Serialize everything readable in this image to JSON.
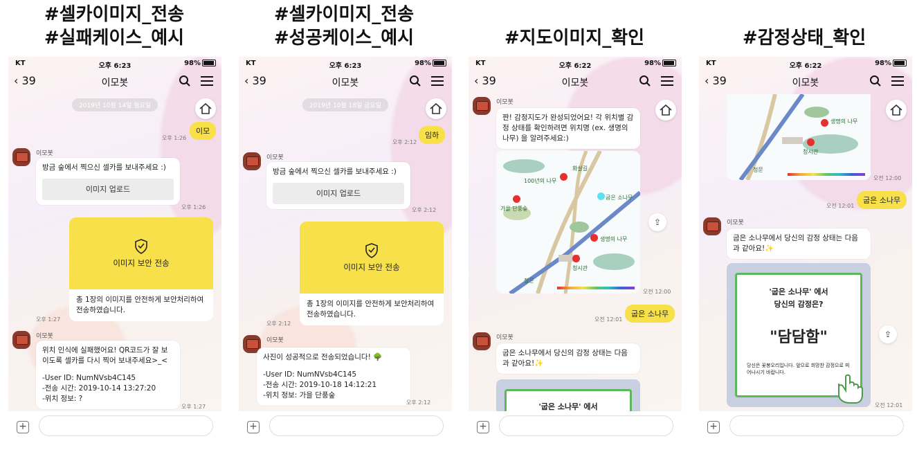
{
  "captions": [
    {
      "line1": "#셀카이미지_전송",
      "line2": "#실패케이스_예시"
    },
    {
      "line1": "#셀카이미지_전송",
      "line2": "#성공케이스_예시"
    },
    {
      "line1": "#지도이미지_확인",
      "line2": ""
    },
    {
      "line1": "#감정상태_확인",
      "line2": ""
    }
  ],
  "status": {
    "carrier": "KT",
    "battery": "98%",
    "time_a": "오후 6:23",
    "time_b": "오후 6:22"
  },
  "nav": {
    "back_count": "39",
    "title": "이모봇"
  },
  "colors": {
    "yellow": "#f7e04a",
    "marker": "#e53030",
    "frame_green": "#5cb85c"
  },
  "phone1": {
    "date": "2019년 10월 14일 월요일",
    "user_msg": "이모",
    "user_time": "오후 1:26",
    "sender": "이모봇",
    "prompt": "방금 숲에서 찍으신 셀카를 보내주세요 :)",
    "upload_btn": "이미지 업로드",
    "prompt_time": "오후 1:26",
    "secure_title": "이미지 보안 전송",
    "secure_body": "총 1장의 이미지를 안전하게 보안처리하여 전송하였습니다.",
    "secure_time": "오후 1:27",
    "sender2": "이모봇",
    "result_line1": "위치 인식에 실패했어요! QR코드가 잘 보이도록 셀카를 다시 찍어 보내주세요>_<",
    "result_user": "-User ID: NumNVsb4C145",
    "result_sent": "-전송 시간: 2019-10-14 13:27:20",
    "result_loc": "-위치 정보: ?",
    "result_time": "오후 1:27"
  },
  "phone2": {
    "date": "2019년 10월 18일 금요일",
    "user_msg": "임하",
    "user_time": "오후 2:12",
    "sender": "이모봇",
    "prompt": "방금 숲에서 찍으신 셀카를 보내주세요 :)",
    "upload_btn": "이미지 업로드",
    "prompt_time": "오후 2:12",
    "secure_title": "이미지 보안 전송",
    "secure_body": "총 1장의 이미지를 안전하게 보안처리하여 전송하였습니다.",
    "secure_time": "오후 2:12",
    "sender2": "이모봇",
    "result_line1": "사진이 성공적으로 전송되었습니다! 🌳",
    "result_user": "-User ID: NumNVsb4C145",
    "result_sent": "-전송 시간: 2019-10-18 14:12:21",
    "result_loc": "-위치 정보: 가을 단풍숲",
    "result_time": "오후 2:12"
  },
  "phone3": {
    "sender": "이모봇",
    "intro": "짠! 감정지도가 완성되었어요! 각 위치별 감정 상태를 확인하려면 위치명 (ex. 생명의 나무) 을 알려주세요:)",
    "map_labels": [
      "100년의 나무",
      "화살길",
      "굽은 소나무",
      "가을 단풍숲",
      "생명의 나무",
      "청시관",
      "정문"
    ],
    "map_time": "오전 12:00",
    "user_msg": "굽은 소나무",
    "user_time": "오전 12:01",
    "sender2": "이모봇",
    "reply": "굽은 소나무에서 당신의 감정 상태는 다음과 같아요!✨",
    "card_peek": "'굽은 소나무' 에서"
  },
  "phone4": {
    "map_labels": [
      "생명의 나무",
      "청시관",
      "정문"
    ],
    "map_time": "오전 12:00",
    "user_msg": "굽은 소나무",
    "user_time": "오전 12:01",
    "sender": "이모봇",
    "reply": "굽은 소나무에서 당신의 감정 상태는 다음과 같아요!✨",
    "card_head1": "'굽은 소나무' 에서",
    "card_head2": "당신의 감정은?",
    "card_emotion": "\"담담함\"",
    "card_desc": "당신은 꽃봉오리입니다. 앞으로 희망찬 감정으로 피어나시기 바랍니다.",
    "card_time": "오전 12:01"
  }
}
